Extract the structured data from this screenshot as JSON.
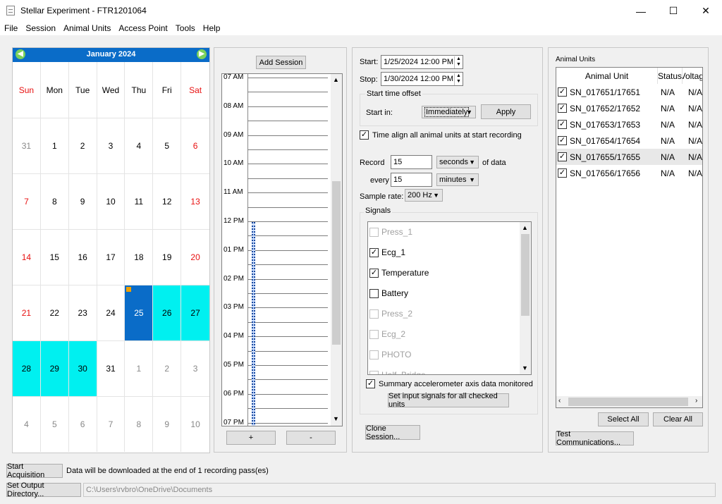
{
  "window": {
    "title": "Stellar Experiment - FTR1201064",
    "minimize": "—",
    "maximize": "☐",
    "close": "✕"
  },
  "menu": [
    "File",
    "Session",
    "Animal Units",
    "Access Point",
    "Tools",
    "Help"
  ],
  "calendar": {
    "month_label": "January  2024",
    "prev": "◀",
    "next": "▶",
    "day_names": [
      "Sun",
      "Mon",
      "Tue",
      "Wed",
      "Thu",
      "Fri",
      "Sat"
    ],
    "weeks": [
      [
        "31",
        "1",
        "2",
        "3",
        "4",
        "5",
        "6"
      ],
      [
        "7",
        "8",
        "9",
        "10",
        "11",
        "12",
        "13"
      ],
      [
        "14",
        "15",
        "16",
        "17",
        "18",
        "19",
        "20"
      ],
      [
        "21",
        "22",
        "23",
        "24",
        "25",
        "26",
        "27"
      ],
      [
        "28",
        "29",
        "30",
        "31",
        "1",
        "2",
        "3"
      ],
      [
        "4",
        "5",
        "6",
        "7",
        "8",
        "9",
        "10"
      ]
    ],
    "selected_start": "25",
    "selected_range": [
      "26",
      "27",
      "28",
      "29",
      "30"
    ],
    "colors": {
      "header": "#0a6cc8",
      "range": "#00f0f0",
      "today_marker": "#f0a000"
    }
  },
  "timeline": {
    "add_session": "Add Session",
    "hours": [
      "07 AM",
      "08 AM",
      "09 AM",
      "10 AM",
      "11 AM",
      "12 PM",
      "01 PM",
      "02 PM",
      "03 PM",
      "04 PM",
      "05 PM",
      "06 PM",
      "07 PM"
    ],
    "plus": "+",
    "minus": "-"
  },
  "session": {
    "start_label": "Start:",
    "start_value": "1/25/2024 12:00 PM",
    "stop_label": "Stop:",
    "stop_value": "1/30/2024 12:00 PM",
    "offset_group": "Start time offset",
    "start_in_label": "Start in:",
    "start_in_value": "Immediately",
    "apply": "Apply",
    "time_align": "Time align all animal units at start recording",
    "record_label": "Record",
    "record_value": "15",
    "record_unit": "seconds",
    "of_data": "of data",
    "every_label": "every",
    "every_value": "15",
    "every_unit": "minutes",
    "sample_rate_label": "Sample rate:",
    "sample_rate_value": "200 Hz",
    "signals_group": "Signals",
    "signals": [
      {
        "name": "Press_1",
        "checked": false,
        "enabled": false
      },
      {
        "name": "Ecg_1",
        "checked": true,
        "enabled": true
      },
      {
        "name": "Temperature",
        "checked": true,
        "enabled": true
      },
      {
        "name": "Battery",
        "checked": false,
        "enabled": true
      },
      {
        "name": "Press_2",
        "checked": false,
        "enabled": false
      },
      {
        "name": "Ecg_2",
        "checked": false,
        "enabled": false
      },
      {
        "name": "PHOTO",
        "checked": false,
        "enabled": false
      },
      {
        "name": "Half_Bridge",
        "checked": false,
        "enabled": false
      }
    ],
    "summary_accel": "Summary accelerometer axis data monitored",
    "set_input": "Set input signals for all checked units",
    "clone": "Clone Session..."
  },
  "animal_units": {
    "group": "Animal Units",
    "headers": [
      "Animal Unit",
      "Status",
      "Voltag"
    ],
    "rows": [
      {
        "name": "SN_017651/17651",
        "status": "N/A",
        "voltage": "N/A"
      },
      {
        "name": "SN_017652/17652",
        "status": "N/A",
        "voltage": "N/A"
      },
      {
        "name": "SN_017653/17653",
        "status": "N/A",
        "voltage": "N/A"
      },
      {
        "name": "SN_017654/17654",
        "status": "N/A",
        "voltage": "N/A"
      },
      {
        "name": "SN_017655/17655",
        "status": "N/A",
        "voltage": "N/A"
      },
      {
        "name": "SN_017656/17656",
        "status": "N/A",
        "voltage": "N/A"
      }
    ],
    "select_all": "Select All",
    "clear_all": "Clear All",
    "test_comm": "Test Communications..."
  },
  "bottom": {
    "start_acq": "Start Acquisition",
    "download_note": "Data will be downloaded at the end of 1 recording pass(es)",
    "set_output": "Set Output Directory...",
    "output_path": "C:\\Users\\rvbro\\OneDrive\\Documents"
  }
}
